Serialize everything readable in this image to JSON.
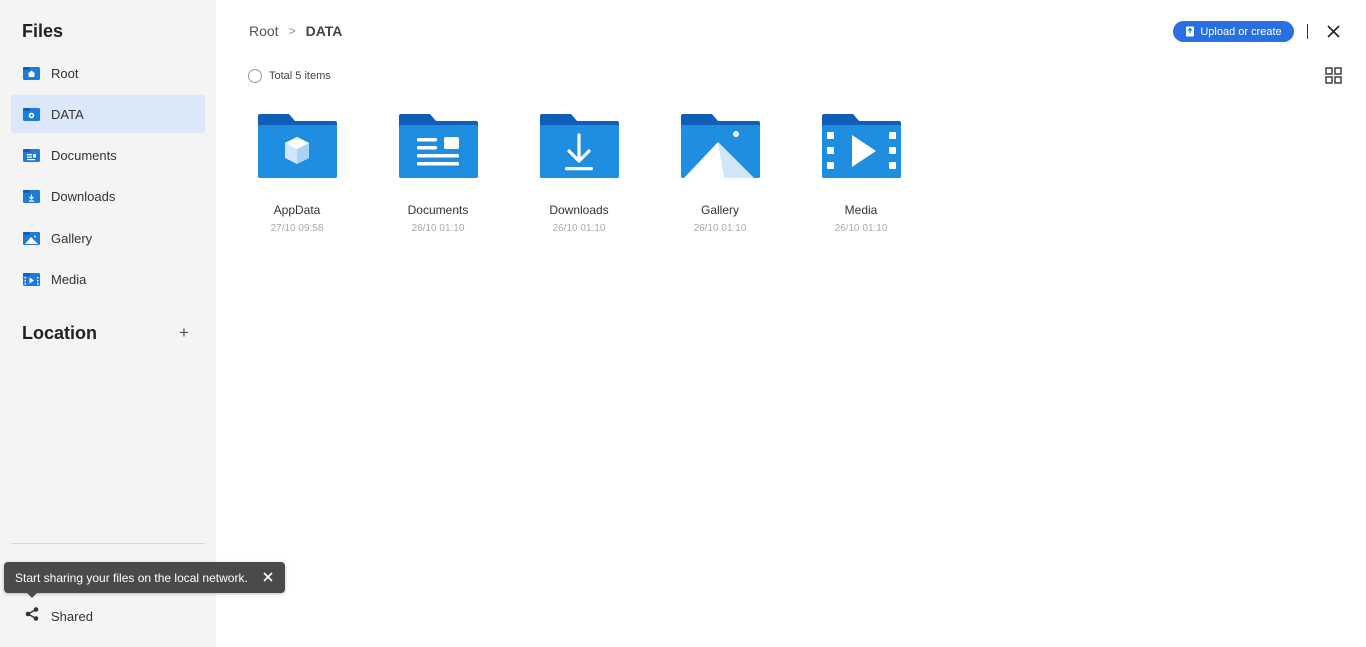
{
  "sidebar": {
    "title": "Files",
    "items": [
      {
        "label": "Root",
        "icon": "home-icon",
        "active": false
      },
      {
        "label": "DATA",
        "icon": "data-icon",
        "active": true
      },
      {
        "label": "Documents",
        "icon": "documents-icon",
        "active": false
      },
      {
        "label": "Downloads",
        "icon": "downloads-icon",
        "active": false
      },
      {
        "label": "Gallery",
        "icon": "gallery-icon",
        "active": false
      },
      {
        "label": "Media",
        "icon": "media-icon",
        "active": false
      }
    ],
    "location_title": "Location",
    "location_add": "+",
    "shared_label": "Shared"
  },
  "tooltip": {
    "text": "Start sharing your files on the local network."
  },
  "header": {
    "breadcrumb": {
      "root": "Root",
      "separator": ">",
      "current": "DATA"
    },
    "upload_label": "Upload or create"
  },
  "toolbar": {
    "total": "Total 5 items"
  },
  "folders": [
    {
      "name": "AppData",
      "date": "27/10 09:58",
      "icon": "appdata-folder-icon"
    },
    {
      "name": "Documents",
      "date": "26/10 01:10",
      "icon": "documents-folder-icon"
    },
    {
      "name": "Downloads",
      "date": "26/10 01:10",
      "icon": "downloads-folder-icon"
    },
    {
      "name": "Gallery",
      "date": "26/10 01:10",
      "icon": "gallery-folder-icon"
    },
    {
      "name": "Media",
      "date": "26/10 01:10",
      "icon": "media-folder-icon"
    }
  ],
  "colors": {
    "accent": "#2a6fe0",
    "folder_dark": "#0f5fb8",
    "folder_light": "#1f8de0",
    "sidebar_bg": "#f4f4f4",
    "active_bg": "#dbe8f9"
  }
}
